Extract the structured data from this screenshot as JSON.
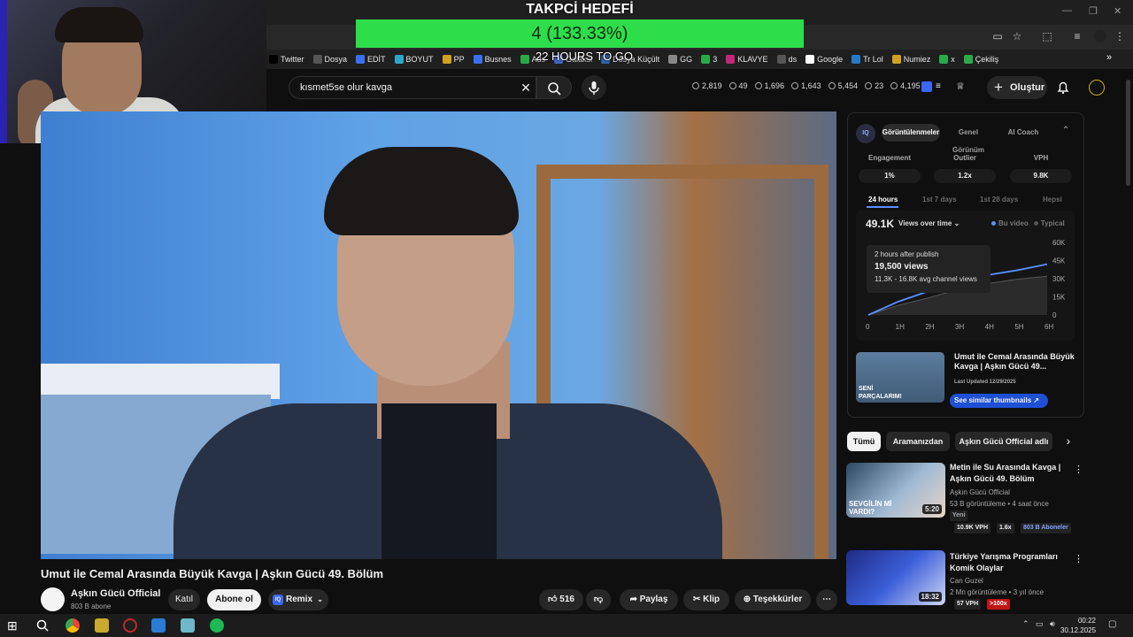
{
  "overlay": {
    "goal_title": "TAKPCİ HEDEFİ",
    "goal_value": "4 (133.33%)",
    "goal_remaining": "22 HOURS TO GO"
  },
  "bookmarks": [
    {
      "label": "Twitter",
      "color": "#000000"
    },
    {
      "label": "Dosya",
      "color": "#555555"
    },
    {
      "label": "EDİT",
      "color": "#3a6ff0"
    },
    {
      "label": "BOYUT",
      "color": "#2aa8c9"
    },
    {
      "label": "PP",
      "color": "#d0a020"
    },
    {
      "label": "Busnes",
      "color": "#3a6ff0"
    },
    {
      "label": "Ads",
      "color": "#2aa84a"
    },
    {
      "label": "Galaksi",
      "color": "#4466cc"
    },
    {
      "label": "Dosya Küçült",
      "color": "#3366aa"
    },
    {
      "label": "GG",
      "color": "#888888"
    },
    {
      "label": "3",
      "color": "#2aa84a"
    },
    {
      "label": "KLAVYE",
      "color": "#c0287a"
    },
    {
      "label": "ds",
      "color": "#555555"
    },
    {
      "label": "Google",
      "color": "#ffffff"
    },
    {
      "label": "Tr Lol",
      "color": "#2a79c9"
    },
    {
      "label": "Numiez",
      "color": "#d0a020"
    },
    {
      "label": "x",
      "color": "#2aa84a"
    },
    {
      "label": "Çekiliş",
      "color": "#2aa84a"
    }
  ],
  "search": {
    "query": "kısmet5se olur kavga"
  },
  "stats": [
    "2,819",
    "49",
    "1,696",
    "1,643",
    "5,454",
    "23",
    "4,195"
  ],
  "header": {
    "create_label": "Oluştur"
  },
  "video": {
    "title": "Umut ile Cemal Arasında Büyük Kavga | Aşkın Gücü 49. Bölüm",
    "channel": "Aşkın Gücü Official",
    "subscribers": "803 B abone",
    "join_label": "Katıl",
    "subscribe_label": "Abone ol",
    "remix_label": "Remix",
    "likes": "516",
    "share_label": "Paylaş",
    "clip_label": "Klip",
    "thanks_label": "Teşekkürler"
  },
  "iq": {
    "logo": "IQ",
    "tabs": [
      "Görüntülenmeler",
      "Genel Görünüm",
      "AI Coach"
    ],
    "metrics": [
      {
        "label": "Engagement",
        "value": "1%"
      },
      {
        "label": "Outlier",
        "value": "1.2x"
      },
      {
        "label": "VPH",
        "value": "9.8K"
      }
    ],
    "ranges": [
      "24 hours",
      "1st 7 days",
      "1st 28 days",
      "Hepsi"
    ],
    "views_total": "49.1K",
    "views_dropdown": "Views over time",
    "legend": [
      "Bu video",
      "Typical"
    ],
    "tooltip": {
      "line1": "2 hours after publish",
      "line2": "19,500 views",
      "line3": "11.3K - 16.8K avg channel views"
    },
    "card": {
      "thumb_text": "SENİ PARÇALARIM!",
      "title": "Umut ile Cemal Arasında Büyük Kavga | Aşkın Gücü 49...",
      "updated": "Last Updated 12/29/2025",
      "similar_label": "See similar thumbnails"
    }
  },
  "chart_data": {
    "type": "line",
    "x": [
      "0",
      "1H",
      "2H",
      "3H",
      "4H",
      "5H",
      "6H"
    ],
    "yticks": [
      "60K",
      "45K",
      "30K",
      "15K",
      "0"
    ],
    "ylim": [
      0,
      60000
    ],
    "series": [
      {
        "name": "Bu video",
        "values": [
          0,
          11000,
          19500,
          28000,
          33000,
          37000,
          42000
        ],
        "color": "#5b8fff"
      },
      {
        "name": "Typical",
        "values": [
          0,
          8000,
          14000,
          21000,
          26000,
          29500,
          32000
        ],
        "color": "#555555"
      }
    ]
  },
  "chips": [
    "Tümü",
    "Aramanızdan",
    "Aşkın Gücü Official adlı"
  ],
  "recs": [
    {
      "title": "Metin ile Su Arasında Kavga | Aşkın Gücü 49. Bölüm",
      "channel": "Aşkın Gücü Official",
      "meta": "53 B görüntüleme • 4 saat önce",
      "badge": "Yeni",
      "duration": "5:20",
      "thumb_text": "SEVGİLİN Mİ VARDI?",
      "vph": "10.9K VPH",
      "ratio": "1.6x",
      "subs": "803 B Aboneler"
    },
    {
      "title": "Türkiye Yarışma Programları Komik Olaylar",
      "channel": "Can Guzel",
      "meta": "2 Mn görüntüleme • 3 yıl önce",
      "duration": "18:32",
      "vph": "57 VPH",
      "ratio": ">100x"
    }
  ],
  "taskbar": {
    "time": "00:22",
    "date": "30.12.2025"
  }
}
